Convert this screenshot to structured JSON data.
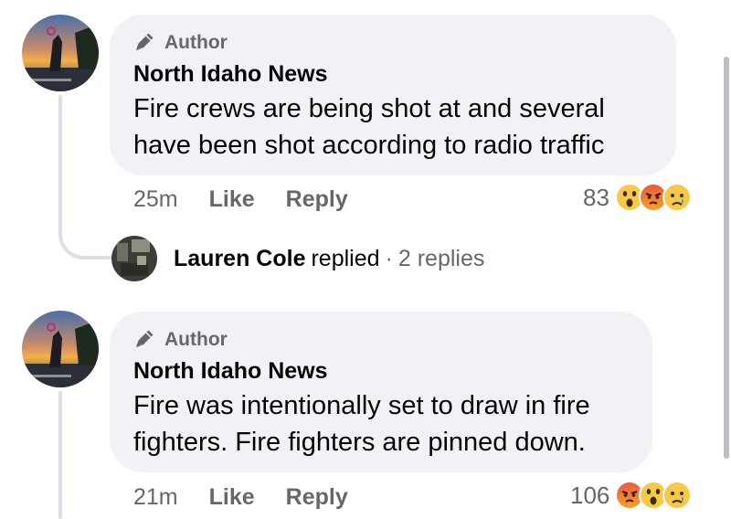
{
  "comments": [
    {
      "badge": "Author",
      "name": "North Idaho News",
      "text_line1": "Fire crews are being shot at and several",
      "text_line2": "have been shot according to radio traffic",
      "time": "25m",
      "like": "Like",
      "reply": "Reply",
      "reaction_count": "83",
      "reactions": [
        "wow-emoji",
        "angry-emoji",
        "sad-emoji"
      ]
    },
    {
      "badge": "Author",
      "name": "North Idaho News",
      "text_line1": "Fire was intentionally set to draw in fire",
      "text_line2": "fighters. Fire fighters are pinned down.",
      "time": "21m",
      "like": "Like",
      "reply": "Reply",
      "reaction_count": "106",
      "reactions": [
        "angry-emoji",
        "wow-emoji",
        "sad-emoji"
      ]
    }
  ],
  "reply_summary": {
    "name": "Lauren Cole",
    "verb": "replied",
    "dot": "·",
    "count": "2 replies"
  },
  "colors": {
    "bubble": "#f0f2f5",
    "secondary_text": "#65676b",
    "thread_line": "#dcdfe4"
  }
}
